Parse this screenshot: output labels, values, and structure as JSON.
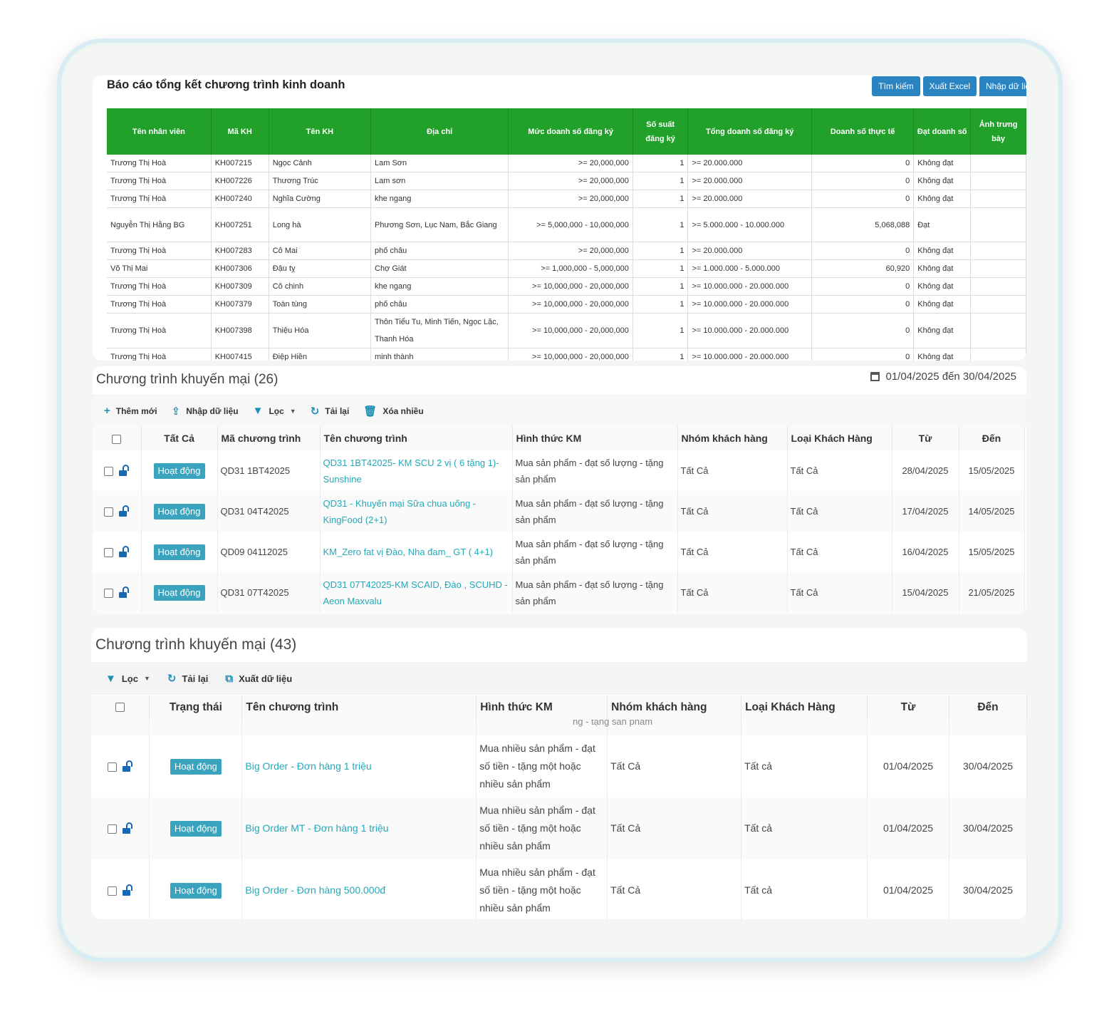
{
  "report": {
    "title": "Báo cáo tổng kết chương trình kinh doanh",
    "buttons": [
      "Tìm kiếm",
      "Xuất Excel",
      "Nhập dữ liệu"
    ],
    "headers": [
      "Tên nhân viên",
      "Mã KH",
      "Tên KH",
      "Địa chỉ",
      "Mức doanh số đăng ký",
      "Số suất đăng ký",
      "Tổng doanh số đăng ký",
      "Doanh số thực tế",
      "Đạt doanh số",
      "Ảnh trưng bày"
    ],
    "rows": [
      [
        "Trương Thị Hoà",
        "KH007215",
        "Ngọc Cảnh",
        "Lam Sơn",
        ">= 20,000,000",
        "1",
        ">= 20.000.000",
        "0",
        "Không đạt",
        ""
      ],
      [
        "Trương Thị Hoà",
        "KH007226",
        "Thương Trúc",
        "Lam sơn",
        ">= 20,000,000",
        "1",
        ">= 20.000.000",
        "0",
        "Không đạt",
        ""
      ],
      [
        "Trương Thị Hoà",
        "KH007240",
        "Nghĩa Cường",
        "khe ngang",
        ">= 20,000,000",
        "1",
        ">= 20.000.000",
        "0",
        "Không đạt",
        ""
      ],
      [
        "Nguyễn Thị Hằng BG",
        "KH007251",
        "Long hà",
        "Phương Sơn, Lục Nam, Bắc Giang",
        ">= 5,000,000 - 10,000,000",
        "1",
        ">= 5.000.000 - 10.000.000",
        "5,068,088",
        "Đạt",
        ""
      ],
      [
        "Trương Thị Hoà",
        "KH007283",
        "Cô Mai",
        "phố châu",
        ">= 20,000,000",
        "1",
        ">= 20.000.000",
        "0",
        "Không đạt",
        ""
      ],
      [
        "Võ Thị Mai",
        "KH007306",
        "Đậu tỵ",
        "Chợ Giát",
        ">= 1,000,000 - 5,000,000",
        "1",
        ">= 1.000.000 - 5.000.000",
        "60,920",
        "Không đạt",
        ""
      ],
      [
        "Trương Thị Hoà",
        "KH007309",
        "Cô chinh",
        "khe ngang",
        ">= 10,000,000 - 20,000,000",
        "1",
        ">= 10.000.000 - 20.000.000",
        "0",
        "Không đạt",
        ""
      ],
      [
        "Trương Thị Hoà",
        "KH007379",
        "Toàn tùng",
        "phố châu",
        ">= 10,000,000 - 20,000,000",
        "1",
        ">= 10.000.000 - 20.000.000",
        "0",
        "Không đạt",
        ""
      ],
      [
        "Trương Thị Hoà",
        "KH007398",
        "Thiệu Hóa",
        "Thôn Tiểu Tu, Minh Tiến, Ngọc Lặc, Thanh Hóa",
        ">= 10,000,000 - 20,000,000",
        "1",
        ">= 10.000.000 - 20.000.000",
        "0",
        "Không đạt",
        ""
      ],
      [
        "Trương Thị Hoà",
        "KH007415",
        "Điệp Hiền",
        "minh thành",
        ">= 10,000,000 - 20,000,000",
        "1",
        ">= 10.000.000 - 20.000.000",
        "0",
        "Không đạt",
        ""
      ]
    ]
  },
  "promo1": {
    "title": "Chương trình khuyến mại (26)",
    "date_range": "01/04/2025 đến 30/04/2025",
    "toolbar": {
      "add": "Thêm mới",
      "import": "Nhập dữ liệu",
      "filter": "Lọc",
      "reload": "Tải lại",
      "delete_many": "Xóa nhiều"
    },
    "headers": [
      "Tất Cả",
      "Mã chương trình",
      "Tên chương trình",
      "Hình thức KM",
      "Nhóm khách hàng",
      "Loại Khách Hàng",
      "Từ",
      "Đến"
    ],
    "rows": [
      {
        "status": "Hoạt động",
        "code": "QD31 1BT42025",
        "name": "QD31 1BT42025- KM SCU 2 vị ( 6 tặng 1)- Sunshine",
        "type": "Mua sản phẩm - đạt số lượng - tặng sản phẩm",
        "group": "Tất Cả",
        "kind": "Tất Cả",
        "from": "28/04/2025",
        "to": "15/05/2025"
      },
      {
        "status": "Hoạt động",
        "code": "QD31 04T42025",
        "name": "QD31 - Khuyến mại Sữa chua uống - KingFood (2+1)",
        "type": "Mua sản phẩm - đạt số lượng - tặng sản phẩm",
        "group": "Tất Cả",
        "kind": "Tất Cả",
        "from": "17/04/2025",
        "to": "14/05/2025"
      },
      {
        "status": "Hoạt động",
        "code": "QD09 04112025",
        "name": "KM_Zero fat vị Đào, Nha đam_ GT ( 4+1)",
        "type": "Mua sản phẩm - đạt số lượng - tặng sản phẩm",
        "group": "Tất Cả",
        "kind": "Tất Cả",
        "from": "16/04/2025",
        "to": "15/05/2025"
      },
      {
        "status": "Hoạt động",
        "code": "QD31 07T42025",
        "name": "QD31 07T42025-KM SCAID, Đào , SCUHD - Aeon Maxvalu",
        "type": "Mua sản phẩm - đạt số lượng - tặng sản phẩm",
        "group": "Tất Cả",
        "kind": "Tất Cả",
        "from": "15/04/2025",
        "to": "21/05/2025"
      }
    ]
  },
  "promo2": {
    "title": "Chương trình khuyến mại (43)",
    "toolbar": {
      "filter": "Lọc",
      "reload": "Tải lại",
      "export": "Xuất dữ liệu"
    },
    "headers": [
      "Trạng thái",
      "Tên chương trình",
      "Hình thức KM",
      "Nhóm khách hàng",
      "Loại Khách Hàng",
      "Từ",
      "Đến"
    ],
    "partial_row_text": "ng - tặng sản phẩm",
    "rows": [
      {
        "status": "Hoạt động",
        "name": "Big Order - Đơn hàng 1 triệu",
        "type": "Mua nhiều sản phẩm - đạt số tiền - tặng một hoặc nhiều sản phẩm",
        "group": "Tất Cả",
        "kind": "Tất cả",
        "from": "01/04/2025",
        "to": "30/04/2025"
      },
      {
        "status": "Hoạt động",
        "name": "Big Order MT - Đơn hàng 1 triệu",
        "type": "Mua nhiều sản phẩm - đạt số tiền - tặng một hoặc nhiều sản phẩm",
        "group": "Tất Cả",
        "kind": "Tất cả",
        "from": "01/04/2025",
        "to": "30/04/2025"
      },
      {
        "status": "Hoạt động",
        "name": "Big Order - Đơn hàng 500.000đ",
        "type": "Mua nhiều sản phẩm - đạt số tiền - tặng một hoặc nhiều sản phẩm",
        "group": "Tất Cả",
        "kind": "Tất cả",
        "from": "01/04/2025",
        "to": "30/04/2025"
      }
    ]
  },
  "colors": {
    "header_green": "#21a12a",
    "button_blue": "#2a84c2",
    "badge": "#3aa3bd",
    "link": "#23a9b8"
  }
}
